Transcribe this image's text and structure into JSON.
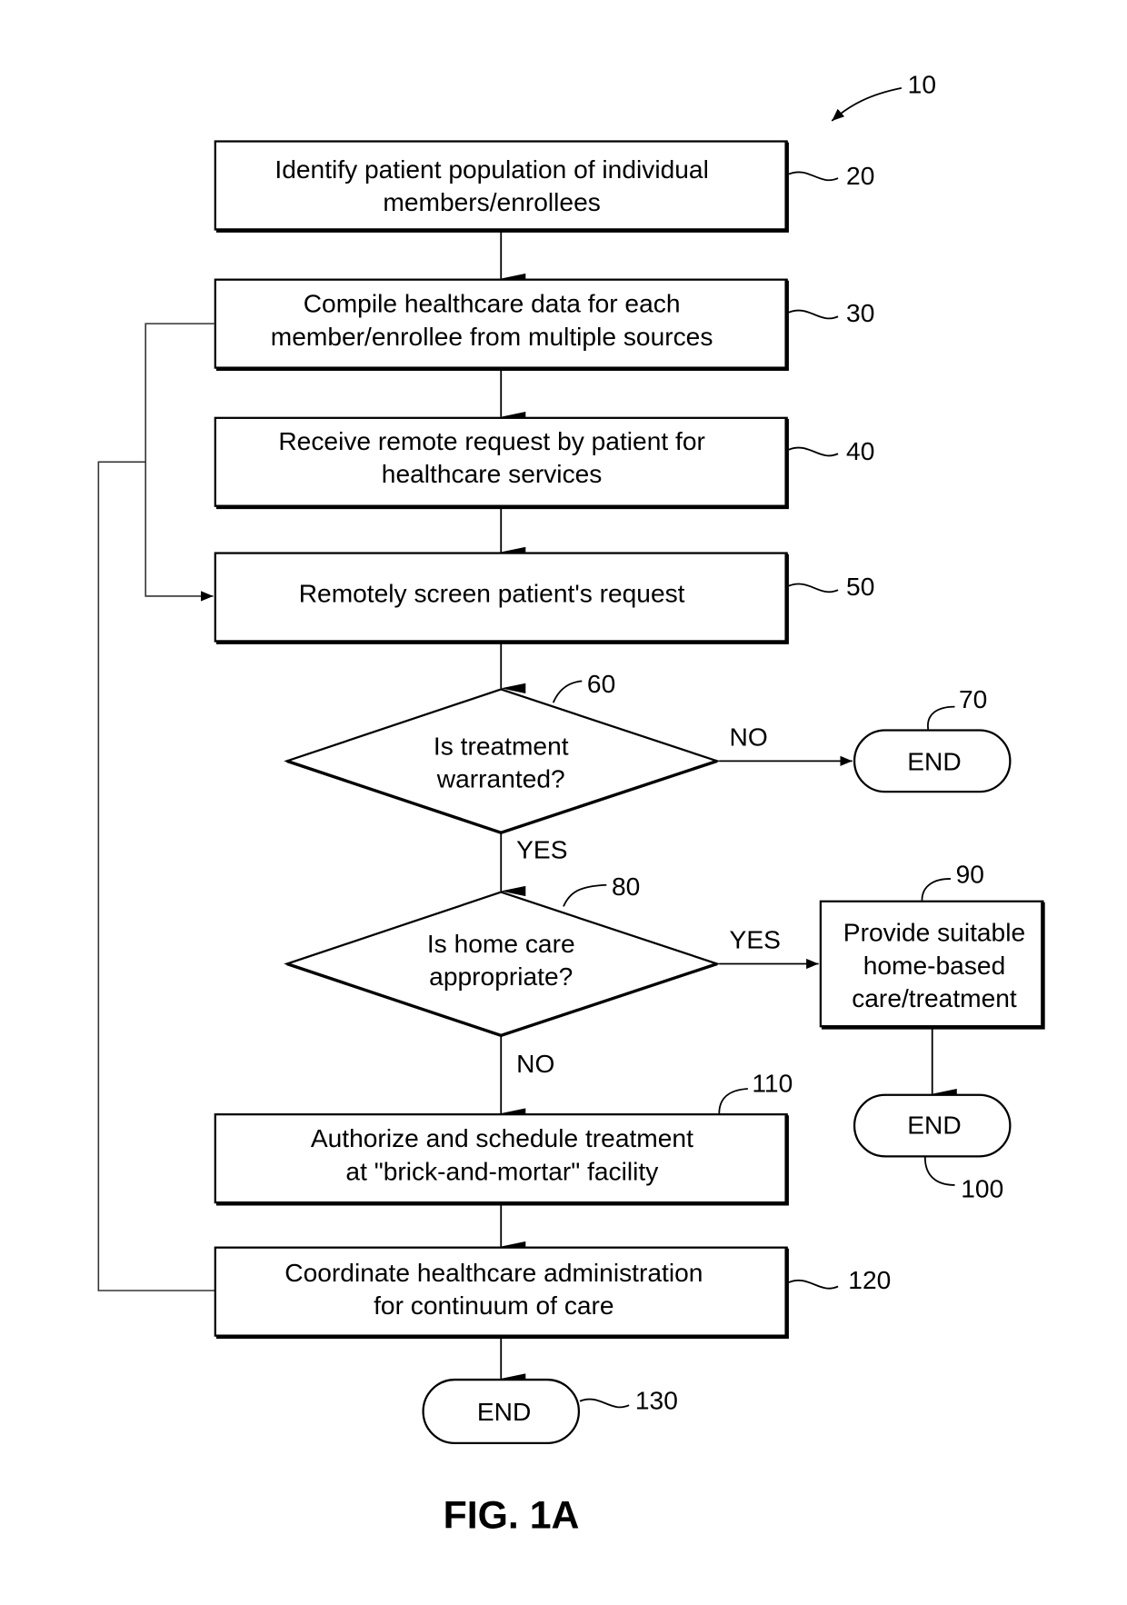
{
  "figure": {
    "caption": "FIG. 1A",
    "reference": "10"
  },
  "steps": [
    {
      "ref": "20",
      "lines": [
        "Identify patient population of individual",
        "members/enrollees"
      ]
    },
    {
      "ref": "30",
      "lines": [
        "Compile healthcare data for each",
        "member/enrollee from multiple sources"
      ]
    },
    {
      "ref": "40",
      "lines": [
        "Receive remote request by patient for",
        "healthcare services"
      ]
    },
    {
      "ref": "50",
      "lines": [
        "Remotely screen patient's request"
      ]
    },
    {
      "ref": "110",
      "lines": [
        "Authorize and schedule treatment",
        "at \"brick-and-mortar\" facility"
      ]
    },
    {
      "ref": "120",
      "lines": [
        "Coordinate healthcare administration",
        "for continuum of care"
      ]
    },
    {
      "ref": "90",
      "lines": [
        "Provide suitable",
        "home-based",
        "care/treatment"
      ]
    }
  ],
  "decisions": [
    {
      "ref": "60",
      "lines": [
        "Is treatment",
        "warranted?"
      ],
      "yes_label": "YES",
      "no_label": "NO"
    },
    {
      "ref": "80",
      "lines": [
        "Is home care",
        "appropriate?"
      ],
      "yes_label": "YES",
      "no_label": "NO"
    }
  ],
  "terminals": [
    {
      "ref": "70",
      "label": "END"
    },
    {
      "ref": "100",
      "label": "END"
    },
    {
      "ref": "130",
      "label": "END"
    }
  ]
}
